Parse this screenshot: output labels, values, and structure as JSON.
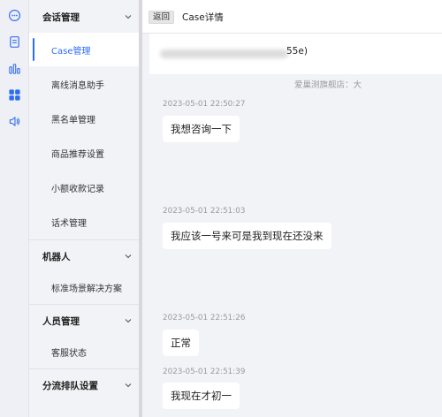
{
  "rail": {
    "icons": [
      "chat-icon",
      "document-icon",
      "stats-icon",
      "apps-icon",
      "speaker-icon"
    ]
  },
  "sidebar": {
    "groups": [
      {
        "title": "会话管理",
        "items": [
          "Case管理",
          "离线消息助手",
          "黑名单管理",
          "商品推荐设置",
          "小额收款记录",
          "话术管理"
        ]
      },
      {
        "title": "机器人",
        "items": [
          "标准场景解决方案"
        ]
      },
      {
        "title": "人员管理",
        "items": [
          "客服状态"
        ]
      },
      {
        "title": "分流排队设置",
        "items": []
      }
    ],
    "active_item": "Case管理"
  },
  "topbar": {
    "back_label": "返回",
    "title": "Case详情"
  },
  "case_header": {
    "id_suffix": "55e)",
    "shop_label": "爱巢测旗舰店：大"
  },
  "messages": [
    {
      "time": "2023-05-01 22:50:27",
      "text": "我想咨询一下"
    },
    {
      "time": "2023-05-01 22:51:03",
      "text": "我应该一号来可是我到现在还没来"
    },
    {
      "time": "2023-05-01 22:51:26",
      "text": "正常"
    },
    {
      "time": "2023-05-01 22:51:39",
      "text": "我现在才初一"
    }
  ],
  "colors": {
    "accent": "#2d6df6",
    "sidebar_bg": "#f2f3f7",
    "chat_bg": "#f2f3f6"
  }
}
